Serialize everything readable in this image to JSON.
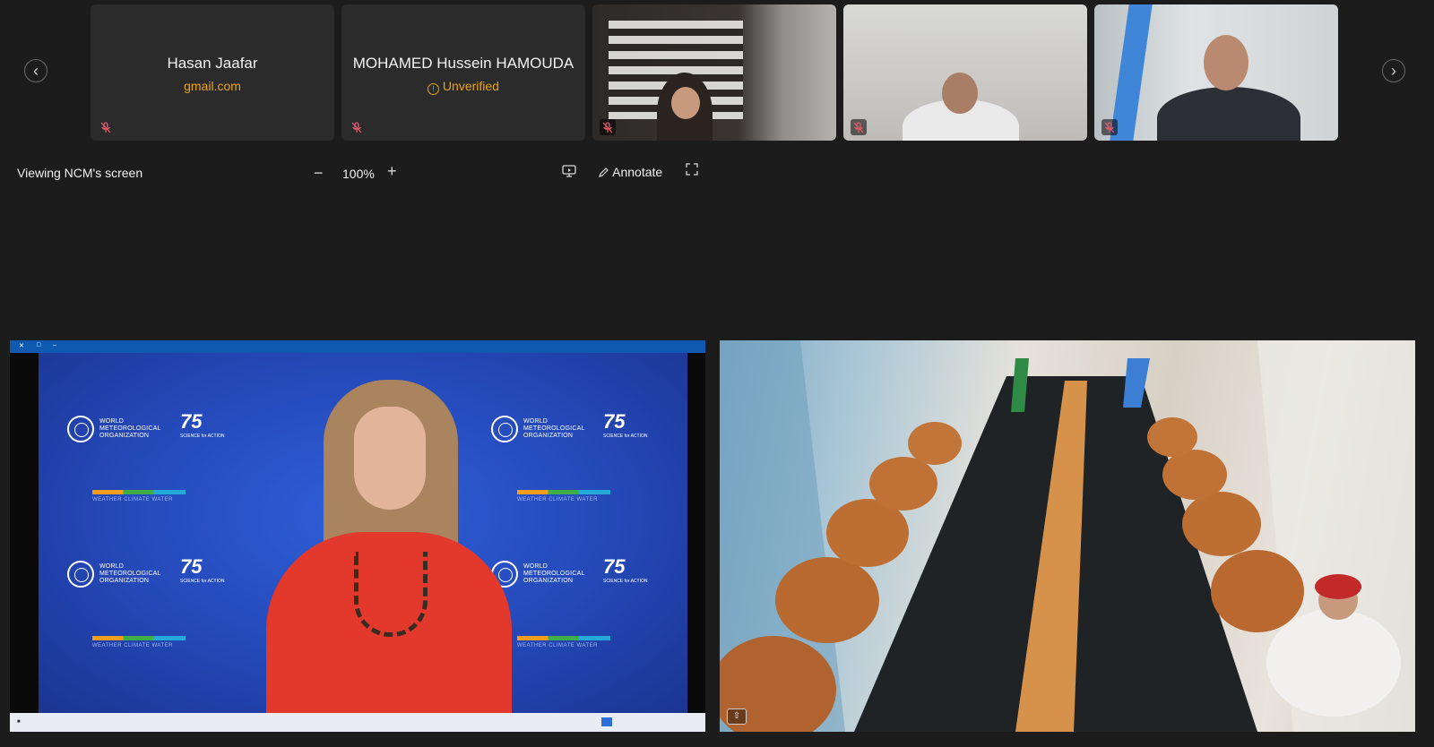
{
  "participants": [
    {
      "name": "Hasan Jaafar",
      "subtitle": "gmail.com",
      "muted": true
    },
    {
      "name": "MOHAMED Hussein HAMOUDA",
      "subtitle": "Unverified",
      "muted": true
    },
    {
      "name": "",
      "subtitle": "",
      "muted": true
    },
    {
      "name": "",
      "subtitle": "",
      "muted": true
    },
    {
      "name": "",
      "subtitle": "",
      "muted": true
    }
  ],
  "screen_share": {
    "label": "Viewing NCM's screen",
    "zoom": "100%",
    "annotate_label": "Annotate"
  },
  "shared_content": {
    "org_name_line1": "WORLD",
    "org_name_line2": "METEOROLOGICAL",
    "org_name_line3": "ORGANIZATION",
    "anniversary": "75",
    "anniversary_tag": "SCIENCE for ACTION",
    "bar_labels": "WEATHER   CLIMATE   WATER"
  },
  "icons": {
    "prev": "chevron-left-icon",
    "next": "chevron-right-icon",
    "mic_off": "mic-off-icon",
    "unverified": "info-circle-icon",
    "zoom_out": "minus-icon",
    "zoom_in": "plus-icon",
    "monitor": "monitor-icon",
    "annotate": "pen-icon",
    "fullscreen": "expand-icon"
  },
  "colors": {
    "background": "#1c1c1c",
    "tile": "#2b2b2b",
    "warning": "#e8a317",
    "mic_off": "#e05a6a",
    "slide_blue": "#2448b8"
  }
}
